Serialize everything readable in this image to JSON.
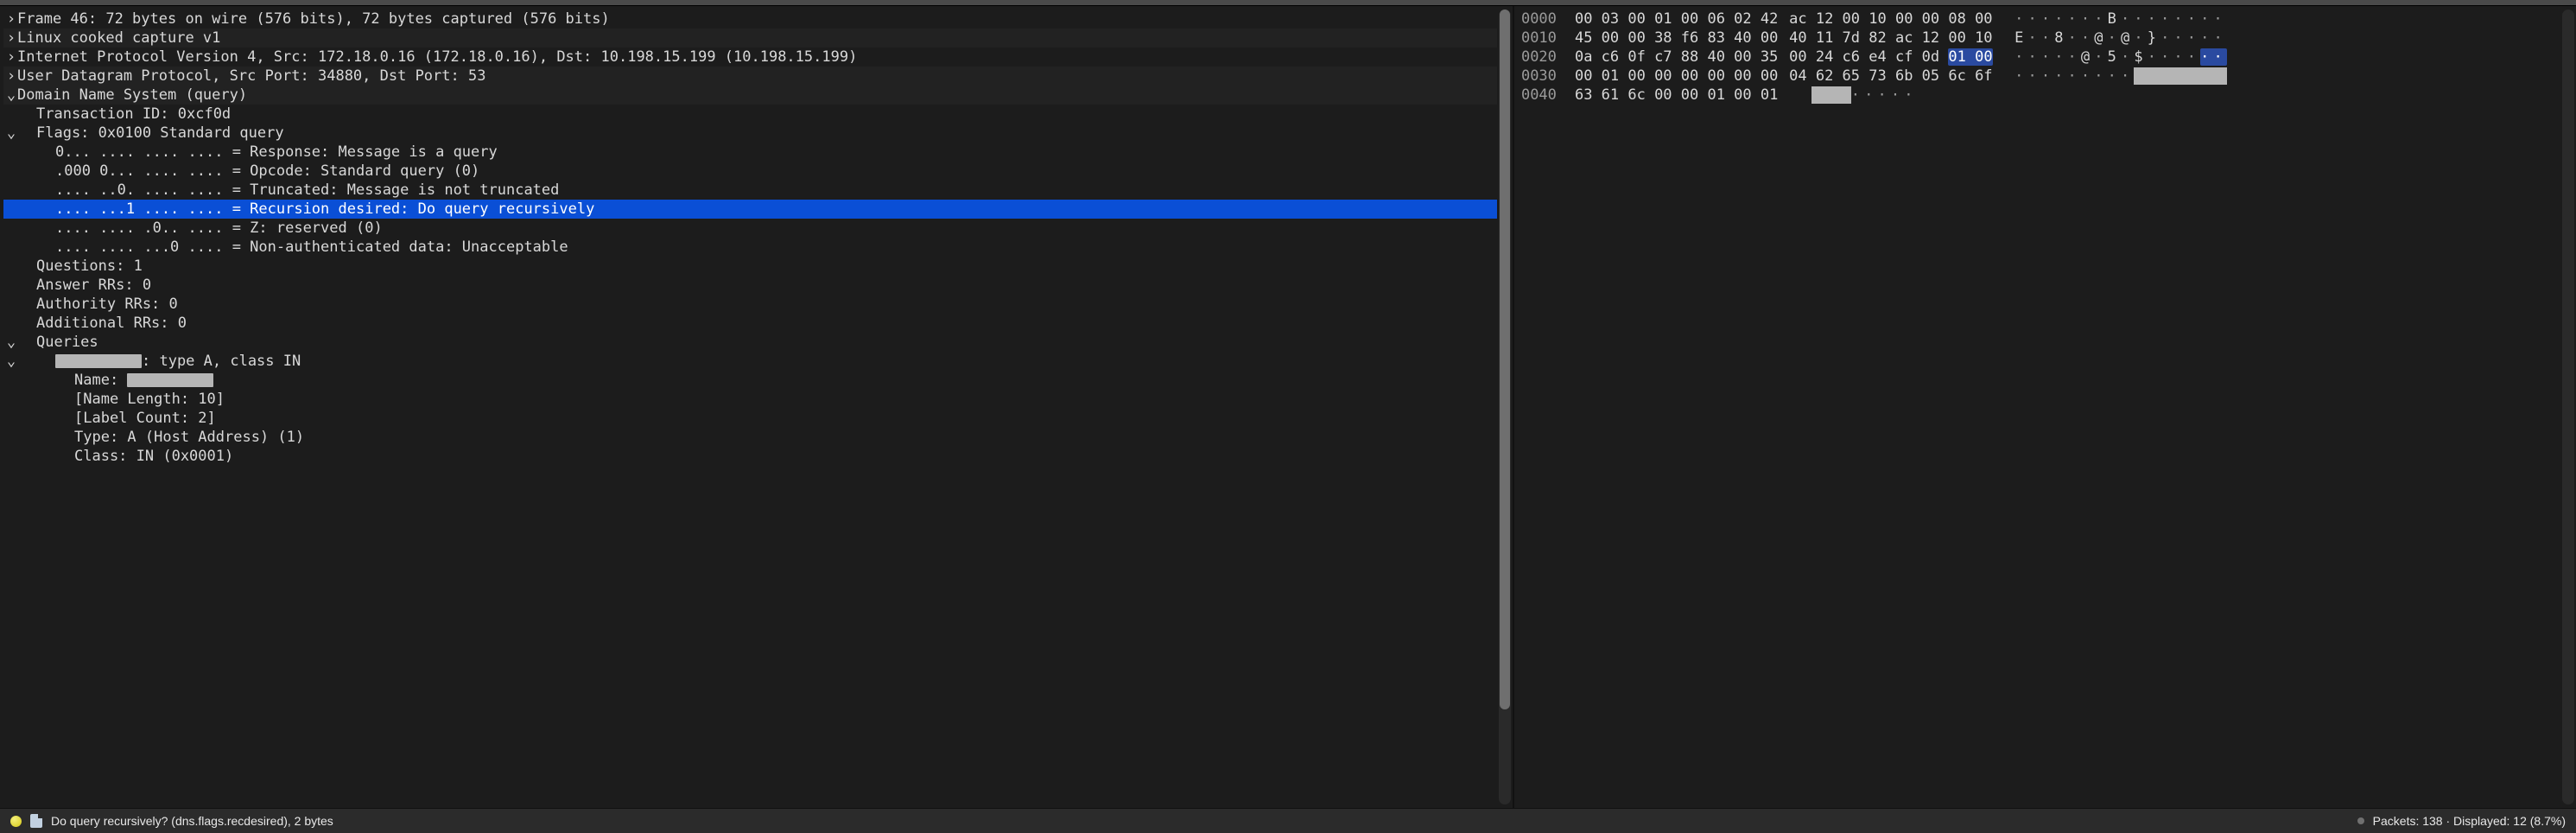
{
  "tree_rows": [
    {
      "indent": 0,
      "arrow": "right",
      "text": "Frame 46: 72 bytes on wire (576 bits), 72 bytes captured (576 bits)",
      "band": false,
      "sel": false,
      "name": "tree-frame"
    },
    {
      "indent": 0,
      "arrow": "right",
      "text": "Linux cooked capture v1",
      "band": true,
      "sel": false,
      "name": "tree-linux-cooked"
    },
    {
      "indent": 0,
      "arrow": "right",
      "text": "Internet Protocol Version 4, Src: 172.18.0.16 (172.18.0.16), Dst: 10.198.15.199 (10.198.15.199)",
      "band": false,
      "sel": false,
      "name": "tree-ip"
    },
    {
      "indent": 0,
      "arrow": "right",
      "text": "User Datagram Protocol, Src Port: 34880, Dst Port: 53",
      "band": true,
      "sel": false,
      "name": "tree-udp"
    },
    {
      "indent": 0,
      "arrow": "down",
      "text": "Domain Name System (query)",
      "band": false,
      "sel": false,
      "name": "tree-dns",
      "dns_header": true
    },
    {
      "indent": 1,
      "arrow": "none",
      "text": "Transaction ID: 0xcf0d",
      "band": false,
      "sel": false,
      "name": "tree-dns-txid"
    },
    {
      "indent": 1,
      "arrow": "down",
      "text": "Flags: 0x0100 Standard query",
      "band": false,
      "sel": false,
      "name": "tree-dns-flags"
    },
    {
      "indent": 2,
      "arrow": "none",
      "text": "0... .... .... .... = Response: Message is a query",
      "band": false,
      "sel": false,
      "name": "tree-flag-response"
    },
    {
      "indent": 2,
      "arrow": "none",
      "text": ".000 0... .... .... = Opcode: Standard query (0)",
      "band": false,
      "sel": false,
      "name": "tree-flag-opcode"
    },
    {
      "indent": 2,
      "arrow": "none",
      "text": ".... ..0. .... .... = Truncated: Message is not truncated",
      "band": false,
      "sel": false,
      "name": "tree-flag-truncated"
    },
    {
      "indent": 2,
      "arrow": "none",
      "text": ".... ...1 .... .... = Recursion desired: Do query recursively",
      "band": false,
      "sel": true,
      "name": "tree-flag-recursion"
    },
    {
      "indent": 2,
      "arrow": "none",
      "text": ".... .... .0.. .... = Z: reserved (0)",
      "band": false,
      "sel": false,
      "name": "tree-flag-z"
    },
    {
      "indent": 2,
      "arrow": "none",
      "text": ".... .... ...0 .... = Non-authenticated data: Unacceptable",
      "band": false,
      "sel": false,
      "name": "tree-flag-ad"
    },
    {
      "indent": 1,
      "arrow": "none",
      "text": "Questions: 1",
      "band": false,
      "sel": false,
      "name": "tree-dns-questions"
    },
    {
      "indent": 1,
      "arrow": "none",
      "text": "Answer RRs: 0",
      "band": false,
      "sel": false,
      "name": "tree-dns-answers"
    },
    {
      "indent": 1,
      "arrow": "none",
      "text": "Authority RRs: 0",
      "band": false,
      "sel": false,
      "name": "tree-dns-authority"
    },
    {
      "indent": 1,
      "arrow": "none",
      "text": "Additional RRs: 0",
      "band": false,
      "sel": false,
      "name": "tree-dns-additional"
    },
    {
      "indent": 1,
      "arrow": "down",
      "text": "Queries",
      "band": false,
      "sel": false,
      "name": "tree-dns-queries"
    },
    {
      "indent": 2,
      "arrow": "down",
      "pre": "",
      "censor": 10,
      "text": ": type A, class IN",
      "band": false,
      "sel": false,
      "name": "tree-query-0"
    },
    {
      "indent": 3,
      "arrow": "none",
      "pre": "Name: ",
      "censor": 10,
      "text": "",
      "band": false,
      "sel": false,
      "name": "tree-query-name"
    },
    {
      "indent": 3,
      "arrow": "none",
      "text": "[Name Length: 10]",
      "band": false,
      "sel": false,
      "name": "tree-query-name-len"
    },
    {
      "indent": 3,
      "arrow": "none",
      "text": "[Label Count: 2]",
      "band": false,
      "sel": false,
      "name": "tree-query-label-count"
    },
    {
      "indent": 3,
      "arrow": "none",
      "text": "Type: A (Host Address) (1)",
      "band": false,
      "sel": false,
      "name": "tree-query-type"
    },
    {
      "indent": 3,
      "arrow": "none",
      "text": "Class: IN (0x0001)",
      "band": false,
      "sel": false,
      "name": "tree-query-class"
    }
  ],
  "hex": {
    "rows": [
      {
        "off": "0000",
        "b1": "00 03 00 01 00 06 02 42",
        "b2": "ac 12 00 10 00 00 08 00",
        "ascii_segments": [
          {
            "t": "·······",
            "c": "mut"
          },
          {
            "t": "B",
            "c": "vis"
          },
          {
            "t": "········",
            "c": "mut"
          }
        ]
      },
      {
        "off": "0010",
        "b1": "45 00 00 38 f6 83 40 00",
        "b2": "40 11 7d 82 ac 12 00 10",
        "ascii_segments": [
          {
            "t": "E",
            "c": "vis"
          },
          {
            "t": "··",
            "c": "mut"
          },
          {
            "t": "8",
            "c": "vis"
          },
          {
            "t": "··",
            "c": "mut"
          },
          {
            "t": "@",
            "c": "vis"
          },
          {
            "t": "·",
            "c": "mut"
          },
          {
            "t": "@",
            "c": "vis"
          },
          {
            "t": "·",
            "c": "mut"
          },
          {
            "t": "}",
            "c": "vis"
          },
          {
            "t": "·····",
            "c": "mut"
          }
        ]
      },
      {
        "off": "0020",
        "b1": "0a c6 0f c7 88 40 00 35",
        "b2_before": "00 24 c6 e4 cf 0d ",
        "b2_sel": "01 00",
        "ascii_segments": [
          {
            "t": "·····",
            "c": "mut"
          },
          {
            "t": "@",
            "c": "vis"
          },
          {
            "t": "·",
            "c": "mut"
          },
          {
            "t": "5",
            "c": "vis"
          },
          {
            "t": "·",
            "c": "mut"
          },
          {
            "t": "$",
            "c": "vis"
          },
          {
            "t": "····",
            "c": "mut"
          },
          {
            "t": "··",
            "c": "sel"
          }
        ]
      },
      {
        "off": "0030",
        "b1": "00 01 00 00 00 00 00 00",
        "b2": "04 62 65 73 6b 05 6c 6f",
        "ascii_segments": [
          {
            "t": "·········",
            "c": "mut"
          },
          {
            "t": "       ",
            "c": "cen"
          }
        ]
      },
      {
        "off": "0040",
        "b1": "63 61 6c 00 00 01 00 01",
        "b2": "",
        "ascii_segments": [
          {
            "t": "   ",
            "c": "cen"
          },
          {
            "t": "·····",
            "c": "mut"
          }
        ]
      }
    ]
  },
  "statusbar": {
    "left": "Do query recursively? (dns.flags.recdesired), 2 bytes",
    "right": "Packets: 138 · Displayed: 12 (8.7%)"
  }
}
